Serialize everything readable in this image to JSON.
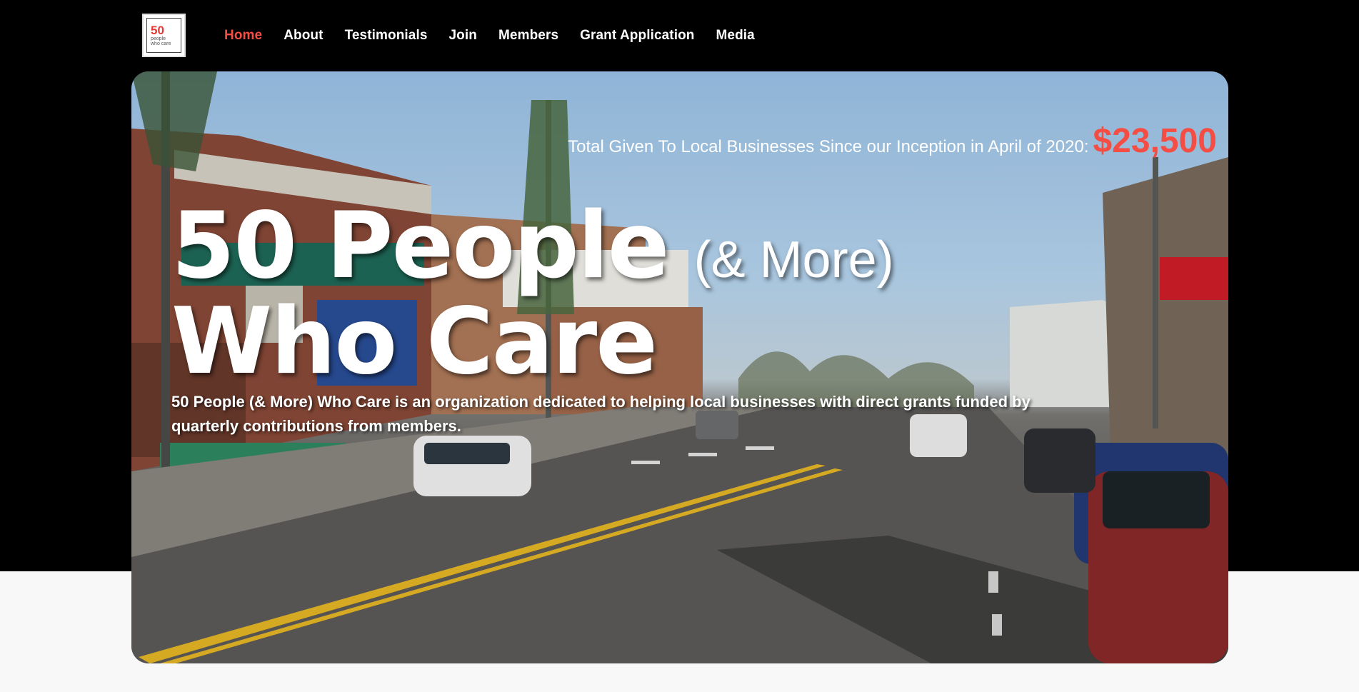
{
  "nav": {
    "logo": {
      "number": "50",
      "line1": "people",
      "line2": "who care"
    },
    "items": [
      {
        "label": "Home",
        "active": true
      },
      {
        "label": "About"
      },
      {
        "label": "Testimonials"
      },
      {
        "label": "Join"
      },
      {
        "label": "Members"
      },
      {
        "label": "Grant Application"
      },
      {
        "label": "Media"
      }
    ]
  },
  "hero": {
    "total_label": "Total Given To Local Businesses Since our Inception in April of 2020:",
    "total_value": "$23,500",
    "title_main": "50 People",
    "title_sub": "(& More)",
    "title_line2": "Who Care",
    "description": "50 People (& More) Who Care is an organization dedicated to helping local businesses with direct grants funded by quarterly contributions from members."
  },
  "colors": {
    "accent": "#f44d44",
    "nav_bg": "#000000",
    "page_bg": "#f8f8f8"
  }
}
